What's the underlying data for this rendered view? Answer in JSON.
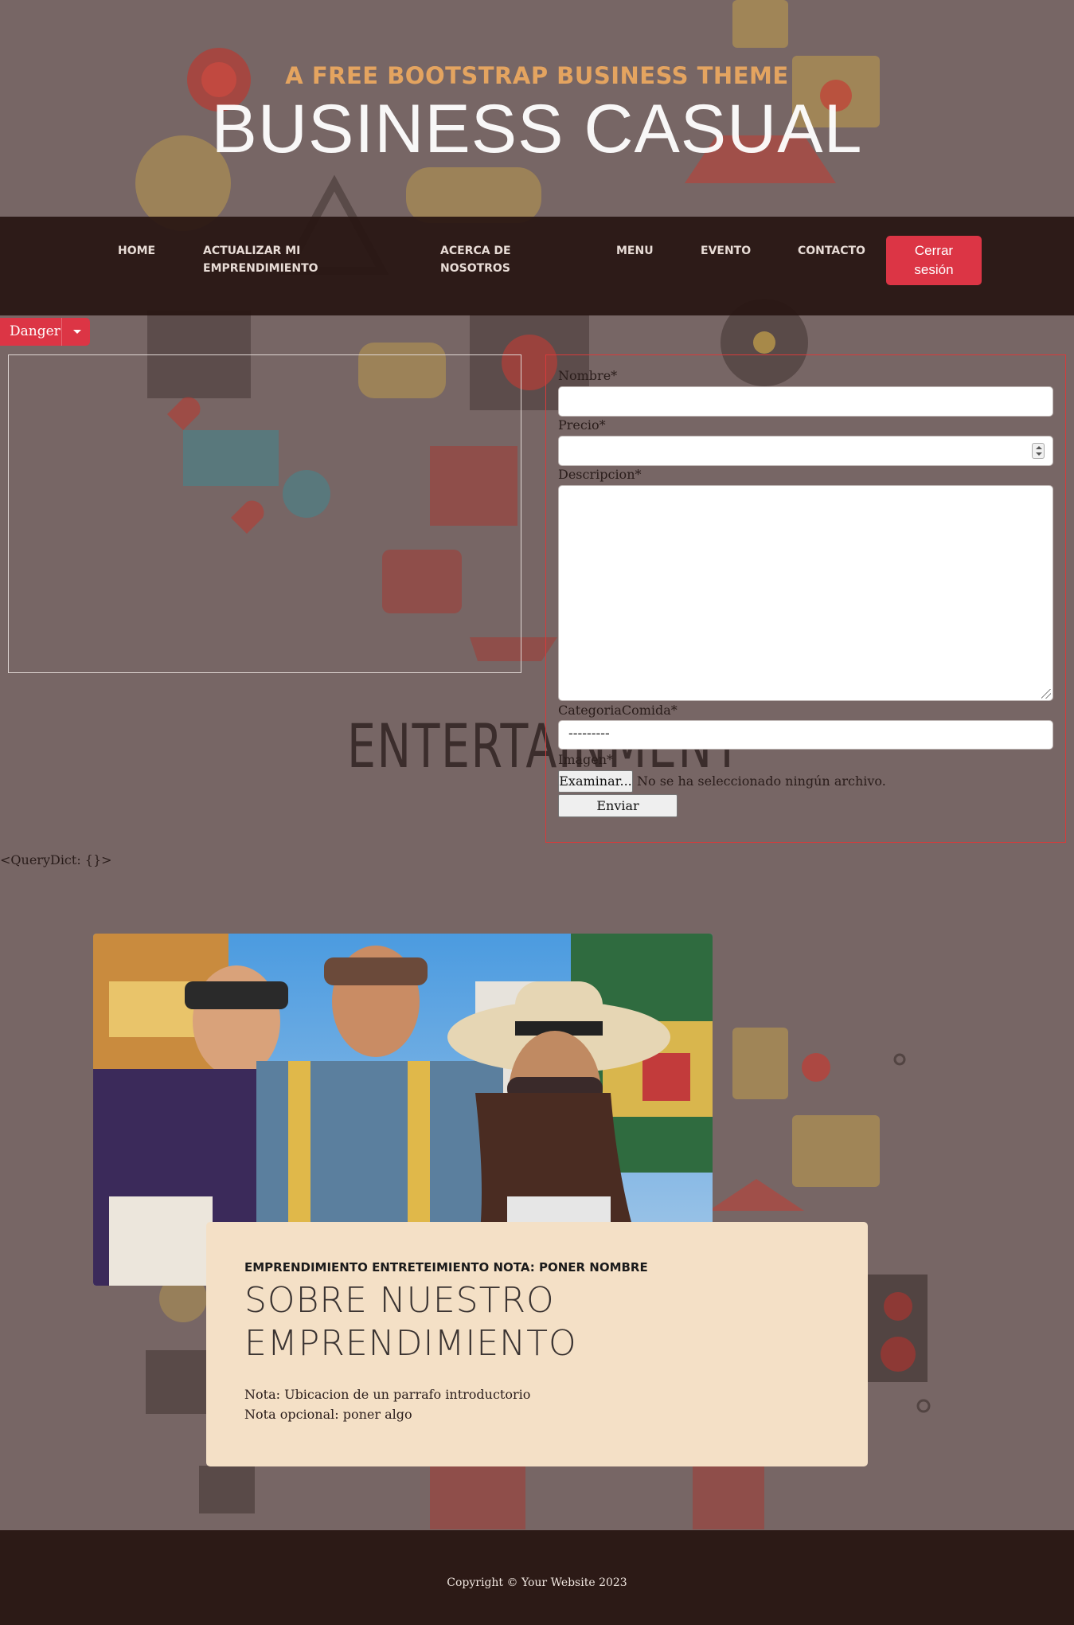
{
  "header": {
    "upper": "A FREE BOOTSTRAP BUSINESS THEME",
    "lower": "BUSINESS CASUAL"
  },
  "nav": {
    "items": [
      {
        "line1": "HOME",
        "line2": ""
      },
      {
        "line1": "ACTUALIZAR MI",
        "line2": "EMPRENDIMIENTO"
      },
      {
        "line1": "ACERCA DE",
        "line2": "NOSOTROS"
      },
      {
        "line1": "MENU",
        "line2": ""
      },
      {
        "line1": "EVENTO",
        "line2": ""
      },
      {
        "line1": "CONTACTO",
        "line2": ""
      }
    ],
    "logout_line1": "Cerrar",
    "logout_line2": "sesión"
  },
  "danger_button": "Danger",
  "watermark": "ENTERTAINMENT",
  "form": {
    "nombre_label": "Nombre*",
    "precio_label": "Precio*",
    "descripcion_label": "Descripcion*",
    "categoria_label": "CategoriaComida*",
    "categoria_value": "---------",
    "imagen_label": "Imagen*",
    "file_button": "Examinar...",
    "file_status": "No se ha seleccionado ningún archivo.",
    "submit": "Enviar"
  },
  "querydict": "<QueryDict: {}>",
  "about": {
    "upper": "EMPRENDIMIENTO ENTRETEIMIENTO NOTA: PONER NOMBRE",
    "lower_line1": "SOBRE NUESTRO",
    "lower_line2": "EMPRENDIMIENTO",
    "p1": "Nota: Ubicacion de un parrafo introductorio",
    "p2": "Nota opcional: poner algo"
  },
  "footer": "Copyright © Your Website 2023",
  "colors": {
    "background": "#776665",
    "navbar": "#281612",
    "accent": "#e4a460",
    "danger": "#dc3545",
    "card": "#f4e0c6"
  }
}
